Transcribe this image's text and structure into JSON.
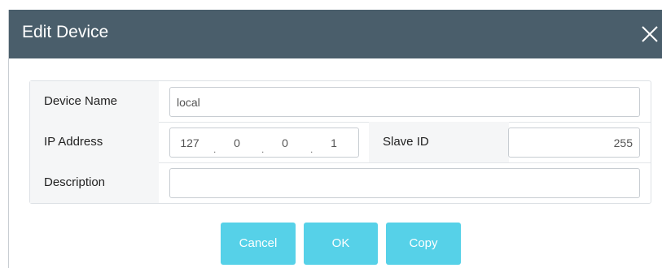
{
  "dialog": {
    "title": "Edit Device"
  },
  "form": {
    "device_name_label": "Device Name",
    "device_name_value": "local",
    "ip_address_label": "IP Address",
    "ip_octets": [
      "127",
      "0",
      "0",
      "1"
    ],
    "ip_separator": ".",
    "slave_id_label": "Slave ID",
    "slave_id_value": "255",
    "description_label": "Description",
    "description_value": ""
  },
  "buttons": {
    "cancel": "Cancel",
    "ok": "OK",
    "copy": "Copy"
  },
  "colors": {
    "titlebar": "#4a5e6b",
    "button": "#56d1e8"
  },
  "icons": {
    "close": "close-icon"
  }
}
